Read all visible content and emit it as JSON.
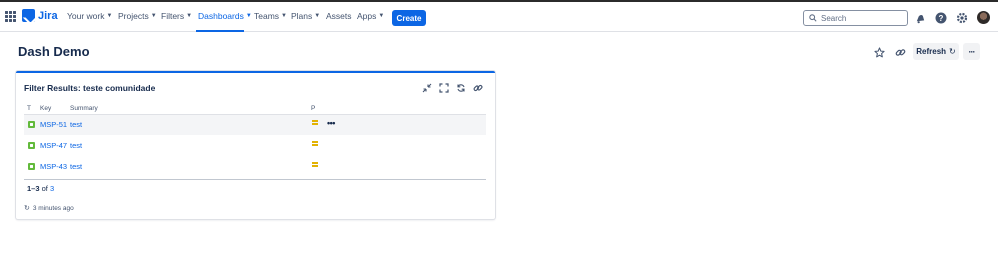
{
  "header": {
    "product": "Jira",
    "nav": [
      {
        "label": "Your work",
        "chevron": true
      },
      {
        "label": "Projects",
        "chevron": true
      },
      {
        "label": "Filters",
        "chevron": true
      },
      {
        "label": "Dashboards",
        "chevron": true,
        "active": true
      },
      {
        "label": "Teams",
        "chevron": true
      },
      {
        "label": "Plans",
        "chevron": true
      },
      {
        "label": "Assets",
        "chevron": false
      },
      {
        "label": "Apps",
        "chevron": true
      }
    ],
    "create_label": "Create",
    "search_placeholder": "Search",
    "icons": [
      "notifications-icon",
      "help-icon",
      "settings-icon",
      "avatar"
    ]
  },
  "page": {
    "title": "Dash Demo",
    "refresh_label": "Refresh",
    "more_label": "···"
  },
  "gadget": {
    "title": "Filter Results: teste comunidade",
    "columns": {
      "type": "T",
      "key": "Key",
      "summary": "Summary",
      "priority": "P"
    },
    "rows": [
      {
        "key": "MSP-51",
        "summary": "test",
        "priority": "Medium"
      },
      {
        "key": "MSP-47",
        "summary": "test",
        "priority": "Medium"
      },
      {
        "key": "MSP-43",
        "summary": "test",
        "priority": "Medium"
      }
    ],
    "row_actions": "•••",
    "pager": {
      "range": "1–3",
      "of": "of",
      "total": "3"
    },
    "updated": "3 minutes ago"
  },
  "colors": {
    "brand": "#0c66e4",
    "story": "#63ba3c",
    "priority_medium": "#e2b203",
    "text": "#172b4d"
  }
}
